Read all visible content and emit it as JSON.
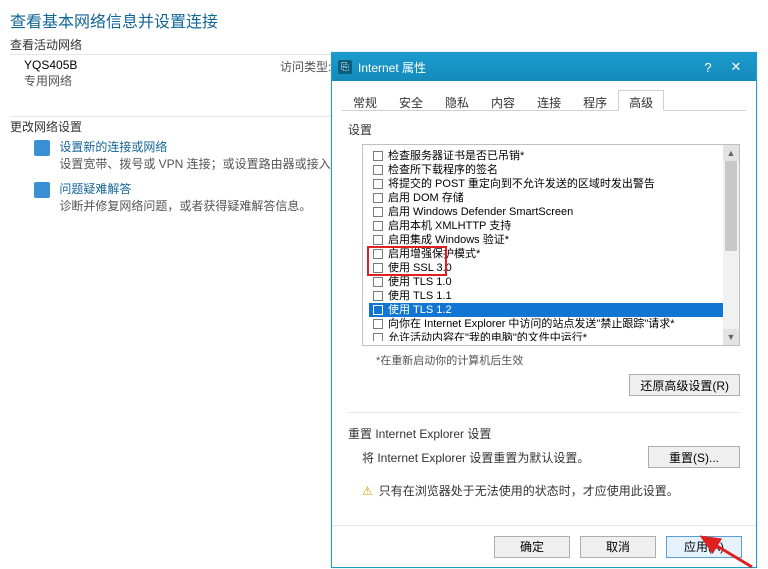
{
  "bg": {
    "heading": "查看基本网络信息并设置连接",
    "active_net_label": "查看活动网络",
    "net_name": "YQS405B",
    "net_type": "专用网络",
    "access_label": "访问类型:",
    "change_label": "更改网络设置",
    "item1_title": "设置新的连接或网络",
    "item1_desc": "设置宽带、拨号或 VPN 连接；或设置路由器或接入点。",
    "item2_title": "问题疑难解答",
    "item2_desc": "诊断并修复网络问题，或者获得疑难解答信息。"
  },
  "dlg": {
    "title": "Internet 属性",
    "help": "?",
    "close": "✕",
    "tabs": [
      "常规",
      "安全",
      "隐私",
      "内容",
      "连接",
      "程序",
      "高级"
    ],
    "active_tab": 6,
    "settings_label": "设置",
    "items": [
      "检查服务器证书是否已吊销*",
      "检查所下载程序的签名",
      "将提交的 POST 重定向到不允许发送的区域时发出警告",
      "启用 DOM 存储",
      "启用 Windows Defender SmartScreen",
      "启用本机 XMLHTTP 支持",
      "启用集成 Windows 验证*",
      "启用增强保护模式*",
      "使用 SSL 3.0",
      "使用 TLS 1.0",
      "使用 TLS 1.1",
      "使用 TLS 1.2",
      "向你在 Internet Explorer 中访问的站点发送\"禁止跟踪\"请求*",
      "允许活动内容在\"我的电脑\"的文件中运行*"
    ],
    "selected_index": 11,
    "note": "*在重新启动你的计算机后生效",
    "restore_btn": "还原高级设置(R)",
    "reset_section": "重置 Internet Explorer 设置",
    "reset_desc": "将 Internet Explorer 设置重置为默认设置。",
    "reset_btn": "重置(S)...",
    "warn_text": "只有在浏览器处于无法使用的状态时，才应使用此设置。",
    "ok": "确定",
    "cancel": "取消",
    "apply": "应用(A)"
  }
}
